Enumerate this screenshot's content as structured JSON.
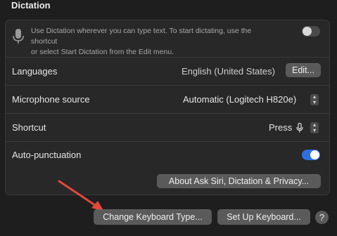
{
  "section": {
    "title": "Dictation"
  },
  "intro": {
    "text_line1": "Use Dictation wherever you can type text. To start dictating, use the shortcut",
    "text_line2": "or select Start Dictation from the Edit menu.",
    "toggle_state": "off"
  },
  "languages": {
    "label": "Languages",
    "value": "English (United States)",
    "button": "Edit..."
  },
  "microphone": {
    "label": "Microphone source",
    "value": "Automatic (Logitech H820e)"
  },
  "shortcut": {
    "label": "Shortcut",
    "value": "Press"
  },
  "autopunct": {
    "label": "Auto-punctuation",
    "toggle_state": "on"
  },
  "about_button": "About Ask Siri, Dictation & Privacy...",
  "footer": {
    "change_keyboard": "Change Keyboard Type...",
    "setup_keyboard": "Set Up Keyboard...",
    "help": "?"
  },
  "colors": {
    "accent": "#2f6fe0",
    "annotation_arrow": "#e0483a"
  }
}
